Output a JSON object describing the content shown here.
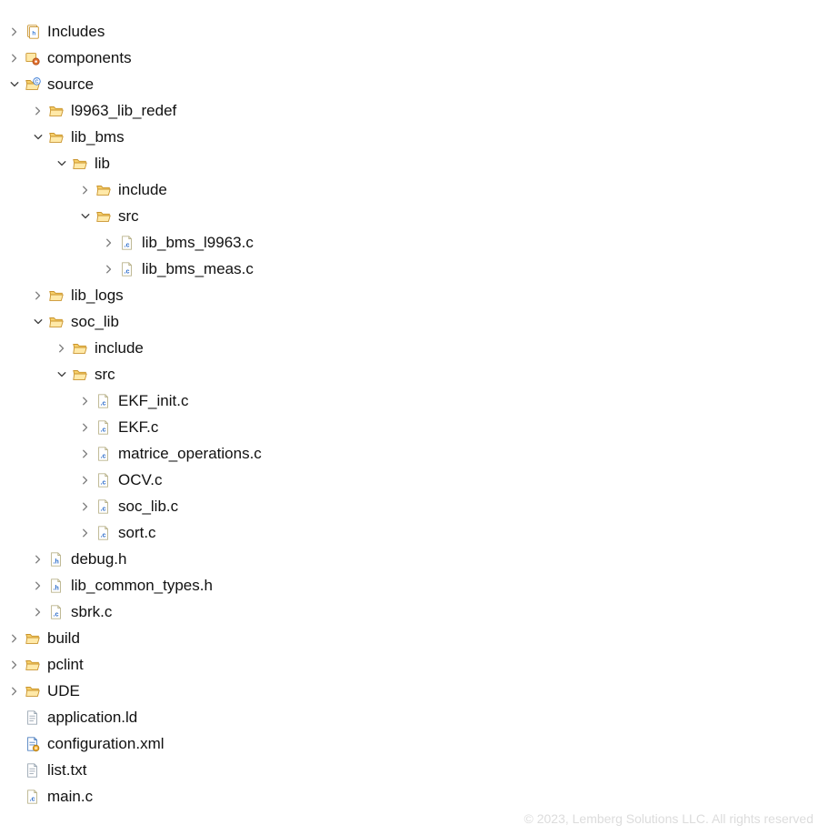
{
  "nodes": [
    {
      "depth": 0,
      "arrow": "right",
      "icon": "includes",
      "label": "Includes"
    },
    {
      "depth": 0,
      "arrow": "right",
      "icon": "component",
      "label": "components"
    },
    {
      "depth": 0,
      "arrow": "down",
      "icon": "srcfolder",
      "label": "source"
    },
    {
      "depth": 1,
      "arrow": "right",
      "icon": "folder",
      "label": "l9963_lib_redef"
    },
    {
      "depth": 1,
      "arrow": "down",
      "icon": "folder",
      "label": "lib_bms"
    },
    {
      "depth": 2,
      "arrow": "down",
      "icon": "folder",
      "label": "lib"
    },
    {
      "depth": 3,
      "arrow": "right",
      "icon": "folder",
      "label": "include"
    },
    {
      "depth": 3,
      "arrow": "down",
      "icon": "folder",
      "label": "src"
    },
    {
      "depth": 4,
      "arrow": "right",
      "icon": "cfile",
      "label": "lib_bms_l9963.c"
    },
    {
      "depth": 4,
      "arrow": "right",
      "icon": "cfile",
      "label": "lib_bms_meas.c"
    },
    {
      "depth": 1,
      "arrow": "right",
      "icon": "folder",
      "label": "lib_logs"
    },
    {
      "depth": 1,
      "arrow": "down",
      "icon": "folder",
      "label": "soc_lib"
    },
    {
      "depth": 2,
      "arrow": "right",
      "icon": "folder",
      "label": "include"
    },
    {
      "depth": 2,
      "arrow": "down",
      "icon": "folder",
      "label": "src"
    },
    {
      "depth": 3,
      "arrow": "right",
      "icon": "cfile",
      "label": "EKF_init.c"
    },
    {
      "depth": 3,
      "arrow": "right",
      "icon": "cfile",
      "label": "EKF.c"
    },
    {
      "depth": 3,
      "arrow": "right",
      "icon": "cfile",
      "label": "matrice_operations.c"
    },
    {
      "depth": 3,
      "arrow": "right",
      "icon": "cfile",
      "label": "OCV.c"
    },
    {
      "depth": 3,
      "arrow": "right",
      "icon": "cfile",
      "label": "soc_lib.c"
    },
    {
      "depth": 3,
      "arrow": "right",
      "icon": "cfile",
      "label": "sort.c"
    },
    {
      "depth": 1,
      "arrow": "right",
      "icon": "hfile",
      "label": "debug.h"
    },
    {
      "depth": 1,
      "arrow": "right",
      "icon": "hfile",
      "label": "lib_common_types.h"
    },
    {
      "depth": 1,
      "arrow": "right",
      "icon": "cfile",
      "label": "sbrk.c"
    },
    {
      "depth": 0,
      "arrow": "right",
      "icon": "folder",
      "label": "build"
    },
    {
      "depth": 0,
      "arrow": "right",
      "icon": "folder",
      "label": "pclint"
    },
    {
      "depth": 0,
      "arrow": "right",
      "icon": "folder",
      "label": "UDE"
    },
    {
      "depth": 0,
      "arrow": "none",
      "icon": "textfile",
      "label": "application.ld"
    },
    {
      "depth": 0,
      "arrow": "none",
      "icon": "config",
      "label": "configuration.xml"
    },
    {
      "depth": 0,
      "arrow": "none",
      "icon": "textfile",
      "label": "list.txt"
    },
    {
      "depth": 0,
      "arrow": "none",
      "icon": "cfile",
      "label": "main.c"
    }
  ],
  "footer": "© 2023, Lemberg Solutions LLC. All rights reserved"
}
